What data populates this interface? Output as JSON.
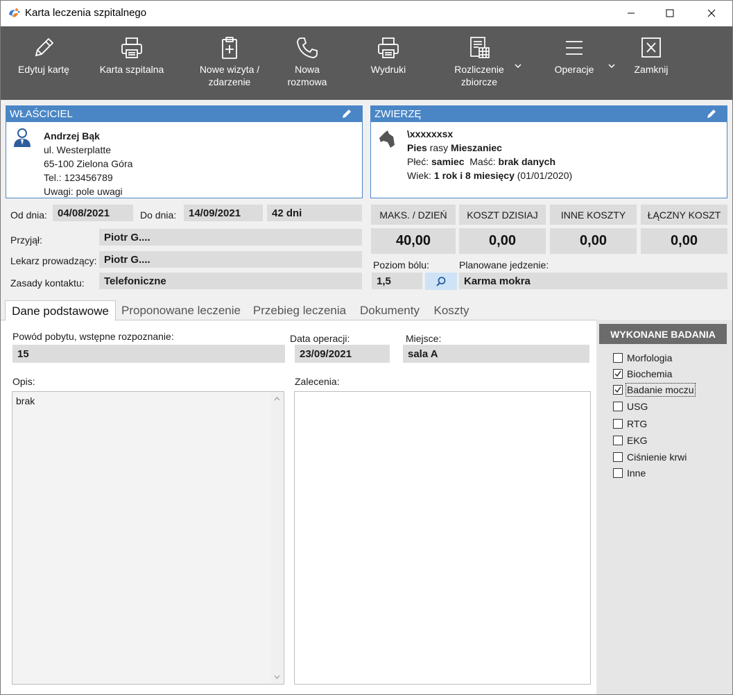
{
  "window": {
    "title": "Karta leczenia szpitalnego"
  },
  "toolbar": {
    "edit_card": "Edytuj kartę",
    "hospital_card": "Karta szpitalna",
    "new_visit": [
      "Nowe wizyta /",
      "zdarzenie"
    ],
    "new_call": [
      "Nowa",
      "rozmowa"
    ],
    "printouts": "Wydruki",
    "collective_settlement": [
      "Rozliczenie",
      "zbiorcze"
    ],
    "operations": "Operacje",
    "close": "Zamknij"
  },
  "owner": {
    "header": "WŁAŚCICIEL",
    "name": "Andrzej Bąk",
    "street": "ul. Westerplatte",
    "city": "65-100  Zielona Góra",
    "phone": "Tel.: 123456789",
    "notes": "Uwagi: pole uwagi"
  },
  "animal": {
    "header": "ZWIERZĘ",
    "name": "\\xxxxxxsx",
    "species": "Pies",
    "breed_label": "rasy",
    "breed": "Mieszaniec",
    "sex_label": "Płeć:",
    "sex": "samiec",
    "color_label": "Maść:",
    "color": "brak danych",
    "age_label": "Wiek:",
    "age": "1 rok i 8 miesięcy",
    "birth": "(01/01/2020)"
  },
  "stay": {
    "from_label": "Od dnia:",
    "from": "04/08/2021",
    "to_label": "Do dnia:",
    "to": "14/09/2021",
    "days": "42 dni",
    "received_label": "Przyjął:",
    "received": "Piotr G....",
    "doctor_label": "Lekarz prowadzący:",
    "doctor": "Piotr G....",
    "contact_label": "Zasady kontaktu:",
    "contact": "Telefoniczne"
  },
  "costs": {
    "max_per_day_label": "MAKS. / DZIEŃ",
    "max_per_day": "40,00",
    "today_label": "KOSZT DZISIAJ",
    "today": "0,00",
    "other_label": "INNE KOSZTY",
    "other": "0,00",
    "total_label": "ŁĄCZNY KOSZT",
    "total": "0,00"
  },
  "pain": {
    "label": "Poziom bólu:",
    "value": "1,5"
  },
  "food": {
    "label": "Planowane jedzenie:",
    "value": "Karma mokra"
  },
  "tabs": [
    "Dane podstawowe",
    "Proponowane leczenie",
    "Przebieg leczenia",
    "Dokumenty",
    "Koszty"
  ],
  "basic": {
    "reason_label": "Powód pobytu, wstępne rozpoznanie:",
    "reason": "15",
    "op_date_label": "Data operacji:",
    "op_date": "23/09/2021",
    "place_label": "Miejsce:",
    "place": "sala A",
    "description_label": "Opis:",
    "description": "brak",
    "recommendations_label": "Zalecenia:",
    "recommendations": ""
  },
  "tests": {
    "header": "WYKONANE BADANIA",
    "items": [
      {
        "label": "Morfologia",
        "checked": false
      },
      {
        "label": "Biochemia",
        "checked": true
      },
      {
        "label": "Badanie moczu",
        "checked": true
      },
      {
        "label": "USG",
        "checked": false
      },
      {
        "label": "RTG",
        "checked": false
      },
      {
        "label": "EKG",
        "checked": false
      },
      {
        "label": "Ciśnienie krwi",
        "checked": false
      },
      {
        "label": "Inne",
        "checked": false
      }
    ]
  },
  "colors": {
    "panel_blue": "#4a86c5",
    "toolbar": "#5a5a5a",
    "field": "#dcdcdc",
    "search_button": "#cfe3f7"
  }
}
